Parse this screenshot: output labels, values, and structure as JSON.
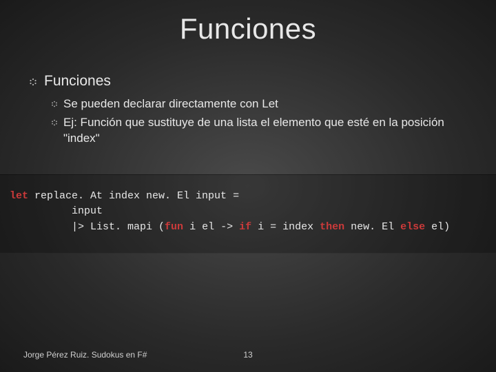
{
  "title": "Funciones",
  "bullets": {
    "l1": "Funciones",
    "subs": [
      "Se pueden declarar directamente con Let",
      "Ej: Función que sustituye de una lista el elemento que esté en la posición \"index\""
    ]
  },
  "code": {
    "line1": {
      "kw": "let",
      "rest": " replace. At index new. El input = "
    },
    "line2": "          input",
    "line3": {
      "pre": "          |> List. mapi (",
      "kw1": "fun",
      "mid1": " i el -> ",
      "kw2": "if",
      "mid2": " i = index ",
      "kw3": "then",
      "mid3": " new. El ",
      "kw4": "else",
      "mid4": " el)"
    }
  },
  "footer": {
    "author": "Jorge Pérez Ruiz. Sudokus en F#",
    "page": "13"
  }
}
